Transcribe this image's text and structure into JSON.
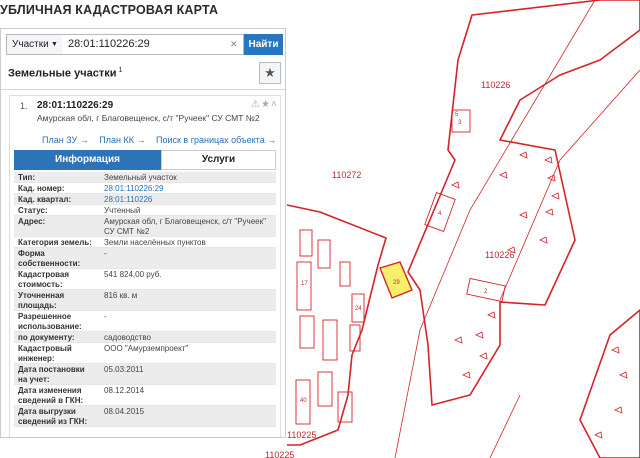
{
  "app": {
    "title": "УБЛИЧНАЯ КАДАСТРОВАЯ КАРТА"
  },
  "search": {
    "type_selected": "Участки",
    "query": "28:01:110226:29",
    "button_label": "Найти"
  },
  "panel": {
    "section_title": "Земельные участки",
    "section_count": "1"
  },
  "result": {
    "index": "1.",
    "cad_number": "28:01:110226:29",
    "address": "Амурская обл, г Благовещенск, с/т \"Ручеек\" СУ СМТ №2",
    "links": [
      "План ЗУ →",
      "План КК →",
      "Поиск в границах объекта →"
    ]
  },
  "tabs": {
    "info": "Информация",
    "services": "Услуги"
  },
  "info_rows": [
    {
      "label": "Тип:",
      "value": "Земельный участок"
    },
    {
      "label": "Кад. номер:",
      "value": "28:01:110226:29"
    },
    {
      "label": "Кад. квартал:",
      "value": "28:01:110226"
    },
    {
      "label": "Статус:",
      "value": "Учтенный"
    },
    {
      "label": "Адрес:",
      "value": "Амурская обл, г Благовещенск, с/т \"Ручеек\" СУ СМТ №2"
    },
    {
      "label": "Категория земель:",
      "value": "Земли населённых пунктов"
    },
    {
      "label": "Форма собственности:",
      "value": "-"
    },
    {
      "label": "Кадастровая стоимость:",
      "value": "541 824,00 руб."
    },
    {
      "label": "Уточненная площадь:",
      "value": "816 кв. м"
    },
    {
      "label": "Разрешенное использование:",
      "value": "-"
    },
    {
      "label": "по документу:",
      "value": "садоводство"
    },
    {
      "label": "Кадастровый инженер:",
      "value": "ООО \"Амурземпроект\""
    },
    {
      "label": "Дата постановки на учет:",
      "value": "05.03.2011"
    },
    {
      "label": "Дата изменения сведений в ГКН:",
      "value": "08.12.2014"
    },
    {
      "label": "Дата выгрузки сведений из ГКН:",
      "value": "08.04.2015"
    }
  ],
  "map": {
    "labels": [
      "110226",
      "110272",
      "110226",
      "110225",
      "110225"
    ],
    "parcel_numbers": [
      "3",
      "4",
      "29",
      "2",
      "5",
      "24",
      "17",
      "40"
    ],
    "colors": {
      "boundary": "#d42329",
      "selected_fill": "#f6ef6a",
      "link": "#2a6fb5",
      "tab_active": "#2d73b8"
    }
  }
}
